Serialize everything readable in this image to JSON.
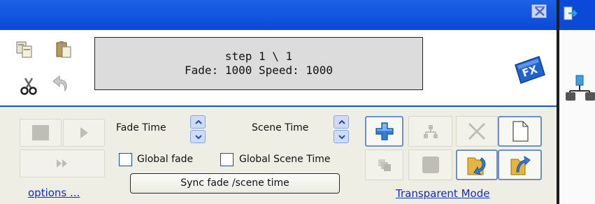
{
  "display": {
    "line1": "step 1 \\ 1",
    "line2": "Fade: 1000  Speed: 1000"
  },
  "fade_time": {
    "label": "Fade Time"
  },
  "scene_time": {
    "label": "Scene Time"
  },
  "checkboxes": {
    "global_fade": {
      "label": "Global fade",
      "checked": false
    },
    "global_scene": {
      "label": "Global Scene Time",
      "checked": false
    }
  },
  "sync_button": {
    "label": "Sync fade /scene time"
  },
  "links": {
    "options": "options ...",
    "transparent": "Transparent Mode"
  },
  "icons": {
    "fx": "FX",
    "names": [
      "copy-icon",
      "paste-icon",
      "cut-icon",
      "undo-icon",
      "fx-icon",
      "close-icon",
      "exit-icon",
      "add-icon",
      "tree-icon",
      "delete-icon",
      "new-page-icon",
      "stack-icon",
      "stop-icon",
      "play-icon",
      "fast-forward-icon",
      "import-icon",
      "export-icon"
    ]
  },
  "colors": {
    "titlebar": "#0b49d8",
    "panel": "#efeee4",
    "link": "#0b2bd6",
    "accent_blue": "#2f7fe0",
    "folder": "#e6b53d"
  }
}
